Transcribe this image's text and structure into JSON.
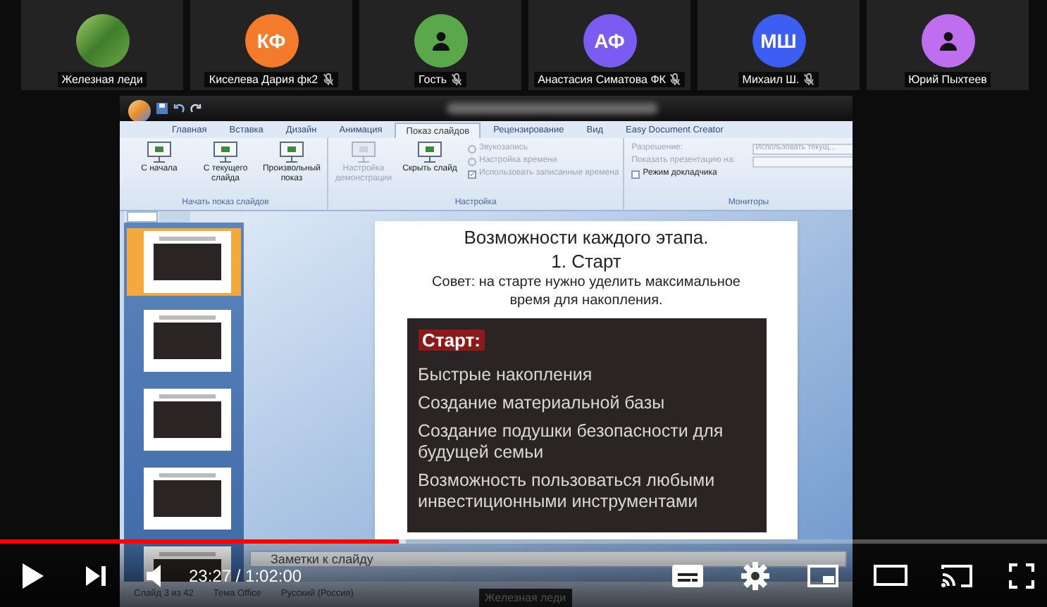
{
  "participants": [
    {
      "name": "Железная леди",
      "kind": "photo",
      "muted": false
    },
    {
      "name": "Киселева Дария фк2",
      "kind": "initials",
      "initials": "КФ",
      "color": "#f47b2c",
      "muted": true
    },
    {
      "name": "Гость",
      "kind": "silhouette",
      "color": "#59a94b",
      "muted": true
    },
    {
      "name": "Анастасия Симатова ФК",
      "kind": "initials",
      "initials": "АФ",
      "color": "#7a5cf2",
      "muted": true
    },
    {
      "name": "Михаил Ш.",
      "kind": "initials",
      "initials": "МШ",
      "color": "#3c5ef2",
      "muted": true
    },
    {
      "name": "Юрий Пыхтеев",
      "kind": "silhouette",
      "color": "#c06ef0",
      "muted": false
    }
  ],
  "powerpoint": {
    "tabs": [
      {
        "label": "Главная",
        "selected": false
      },
      {
        "label": "Вставка",
        "selected": false
      },
      {
        "label": "Дизайн",
        "selected": false
      },
      {
        "label": "Анимация",
        "selected": false
      },
      {
        "label": "Показ слайдов",
        "selected": true
      },
      {
        "label": "Рецензирование",
        "selected": false
      },
      {
        "label": "Вид",
        "selected": false
      },
      {
        "label": "Easy Document Creator",
        "selected": false
      }
    ],
    "ribbon_groups": [
      {
        "label": "Начать показ слайдов",
        "items": [
          {
            "kind": "large",
            "label": "С начала",
            "disabled": false
          },
          {
            "kind": "large",
            "label": "С текущего слайда",
            "disabled": false
          },
          {
            "kind": "large",
            "label": "Произвольный показ",
            "disabled": false
          }
        ]
      },
      {
        "label": "Настройка",
        "items": [
          {
            "kind": "large",
            "label": "Настройка демонстрации",
            "disabled": true
          },
          {
            "kind": "large",
            "label": "Скрыть слайд",
            "disabled": false
          },
          {
            "kind": "small",
            "label": "Звукозапись",
            "disabled": true
          },
          {
            "kind": "small",
            "label": "Настройка времени",
            "disabled": true
          },
          {
            "kind": "checkbox",
            "label": "Использовать записанные времена",
            "disabled": true,
            "checked": true
          }
        ]
      },
      {
        "label": "Мониторы",
        "items": [
          {
            "kind": "dropdown",
            "label": "Разрешение:",
            "value": "Использовать текущ...",
            "disabled": true
          },
          {
            "kind": "dropdown",
            "label": "Показать презентацию на:",
            "disabled": true
          },
          {
            "kind": "checkbox",
            "label": "Режим докладчика",
            "disabled": false,
            "checked": false
          }
        ]
      }
    ],
    "thumbnails": [
      {
        "selected": true
      },
      {
        "selected": false
      },
      {
        "selected": false
      },
      {
        "selected": false
      },
      {
        "selected": false
      }
    ],
    "slide": {
      "title": "Возможности каждого этапа.",
      "subtitle": "1. Старт",
      "tip": "Совет: на старте нужно уделить максимальное время для накопления.",
      "box_heading": "Старт:",
      "box_items": [
        "Быстрые накопления",
        "Создание материальной базы",
        "Создание подушки безопасности для будущей семьи",
        "Возможность пользоваться любыми инвестиционными инструментами"
      ]
    },
    "notes_placeholder": "Заметки к слайду",
    "status_bar": [
      "Слайд 3 из 42",
      "Тема Office",
      "Русский (Россия)"
    ]
  },
  "share_label": "Железная леди",
  "player": {
    "progress": {
      "level": 0.381
    },
    "buffered": {
      "level": 0.387
    },
    "time": "23:27 / 1:02:00"
  }
}
